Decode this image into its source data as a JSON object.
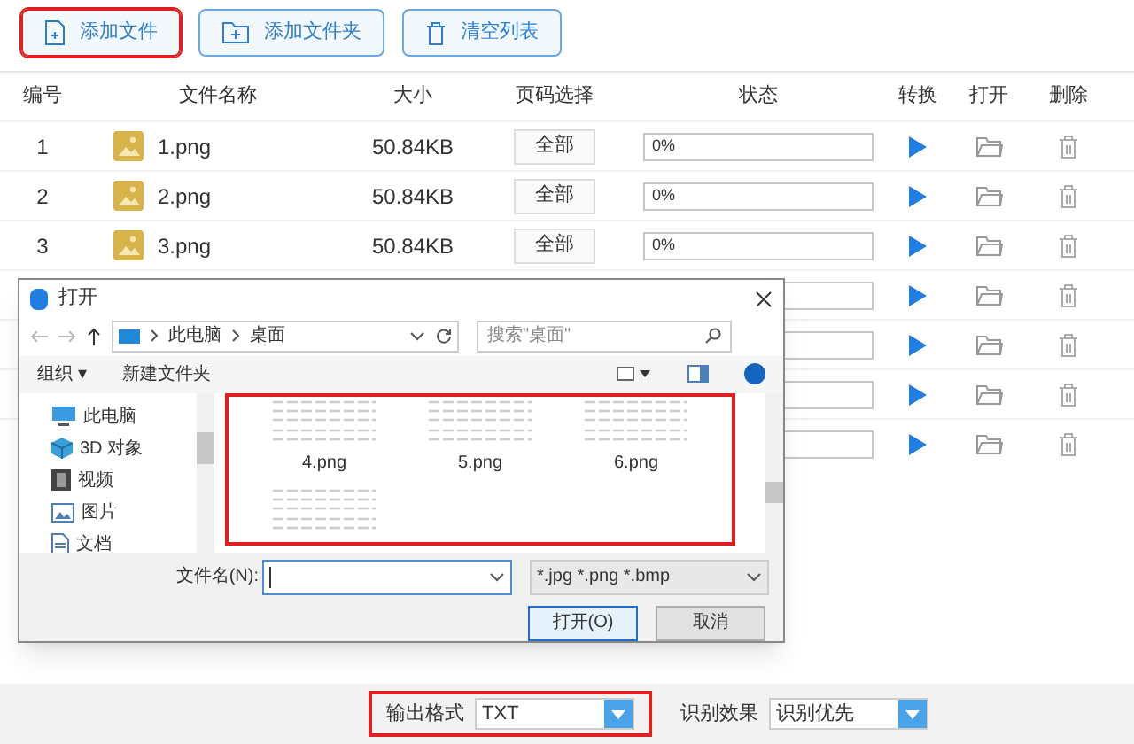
{
  "toolbar": [
    {
      "kind": "file",
      "label": "添加文件",
      "highlighted": true
    },
    {
      "kind": "folder",
      "label": "添加文件夹",
      "highlighted": false
    },
    {
      "kind": "trash",
      "label": "清空列表",
      "highlighted": false
    }
  ],
  "table": {
    "columns": [
      "编号",
      "文件名称",
      "大小",
      "页码选择",
      "状态",
      "转换",
      "打开",
      "删除"
    ],
    "rows": [
      {
        "kind": "full",
        "number": "1",
        "name": "1.png",
        "size": "50.84KB",
        "pages": "全部",
        "status": "0%",
        "level": 0
      },
      {
        "kind": "full",
        "number": "2",
        "name": "2.png",
        "size": "50.84KB",
        "pages": "全部",
        "status": "0%",
        "level": 0
      },
      {
        "kind": "full",
        "number": "3",
        "name": "3.png",
        "size": "50.84KB",
        "pages": "全部",
        "status": "0%",
        "level": 0
      },
      {
        "kind": "covered",
        "level": 0
      },
      {
        "kind": "covered",
        "level": 0
      },
      {
        "kind": "covered",
        "level": 0
      },
      {
        "kind": "covered",
        "level": 0
      }
    ]
  },
  "dialog": {
    "title": "打开",
    "path": [
      "此电脑",
      "桌面"
    ],
    "search_placeholder": "搜索\"桌面\"",
    "commands": [
      "组织 ▾",
      "新建文件夹"
    ],
    "nav": [
      {
        "kind": "pc",
        "label": "此电脑"
      },
      {
        "kind": "cube",
        "label": "3D 对象"
      },
      {
        "kind": "video",
        "label": "视频"
      },
      {
        "kind": "picture",
        "label": "图片"
      },
      {
        "kind": "doc",
        "label": "文档"
      }
    ],
    "files": [
      {
        "kind": "labeled",
        "label": "4.png"
      },
      {
        "kind": "labeled",
        "label": "5.png"
      },
      {
        "kind": "labeled",
        "label": "6.png"
      },
      {
        "kind": "unlabeled"
      }
    ],
    "files_highlighted": true,
    "filename_label": "文件名(N):",
    "filter": "*.jpg *.png *.bmp",
    "buttons": [
      {
        "label": "打开(O)",
        "primary": true
      },
      {
        "label": "取消",
        "primary": false
      }
    ]
  },
  "bottom": {
    "fields": [
      {
        "label": "输出格式",
        "value": "TXT",
        "highlighted": true
      },
      {
        "label": "识别效果",
        "value": "识别优先",
        "highlighted": false
      }
    ]
  }
}
